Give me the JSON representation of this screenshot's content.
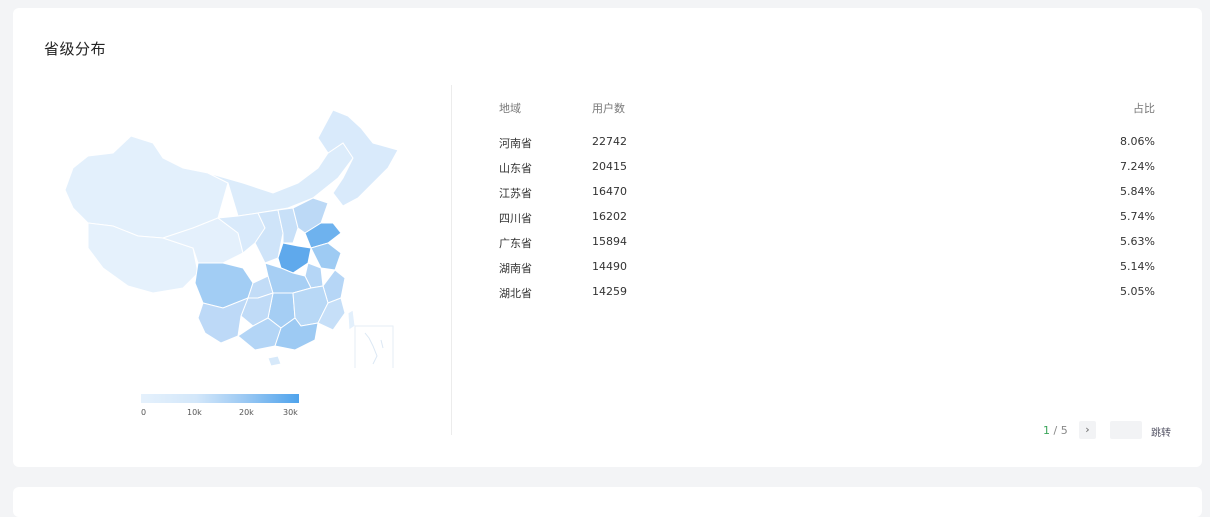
{
  "section": {
    "title": "省级分布"
  },
  "legend": {
    "labels": [
      "0",
      "10k",
      "20k",
      "30k"
    ],
    "colors": [
      "#e5f1fc",
      "#d3e7fa",
      "#9cc9f3",
      "#4fa3ec"
    ]
  },
  "table": {
    "headers": {
      "region": "地域",
      "users": "用户数",
      "ratio": "占比"
    },
    "rows": [
      {
        "region": "河南省",
        "users": "22742",
        "ratio": "8.06%"
      },
      {
        "region": "山东省",
        "users": "20415",
        "ratio": "7.24%"
      },
      {
        "region": "江苏省",
        "users": "16470",
        "ratio": "5.84%"
      },
      {
        "region": "四川省",
        "users": "16202",
        "ratio": "5.74%"
      },
      {
        "region": "广东省",
        "users": "15894",
        "ratio": "5.63%"
      },
      {
        "region": "湖南省",
        "users": "14490",
        "ratio": "5.14%"
      },
      {
        "region": "湖北省",
        "users": "14259",
        "ratio": "5.05%"
      }
    ]
  },
  "pagination": {
    "current": "1",
    "separator": "/",
    "total": "5",
    "next_icon": "chevron-right-icon",
    "jump_label": "跳转",
    "jump_value": ""
  }
}
